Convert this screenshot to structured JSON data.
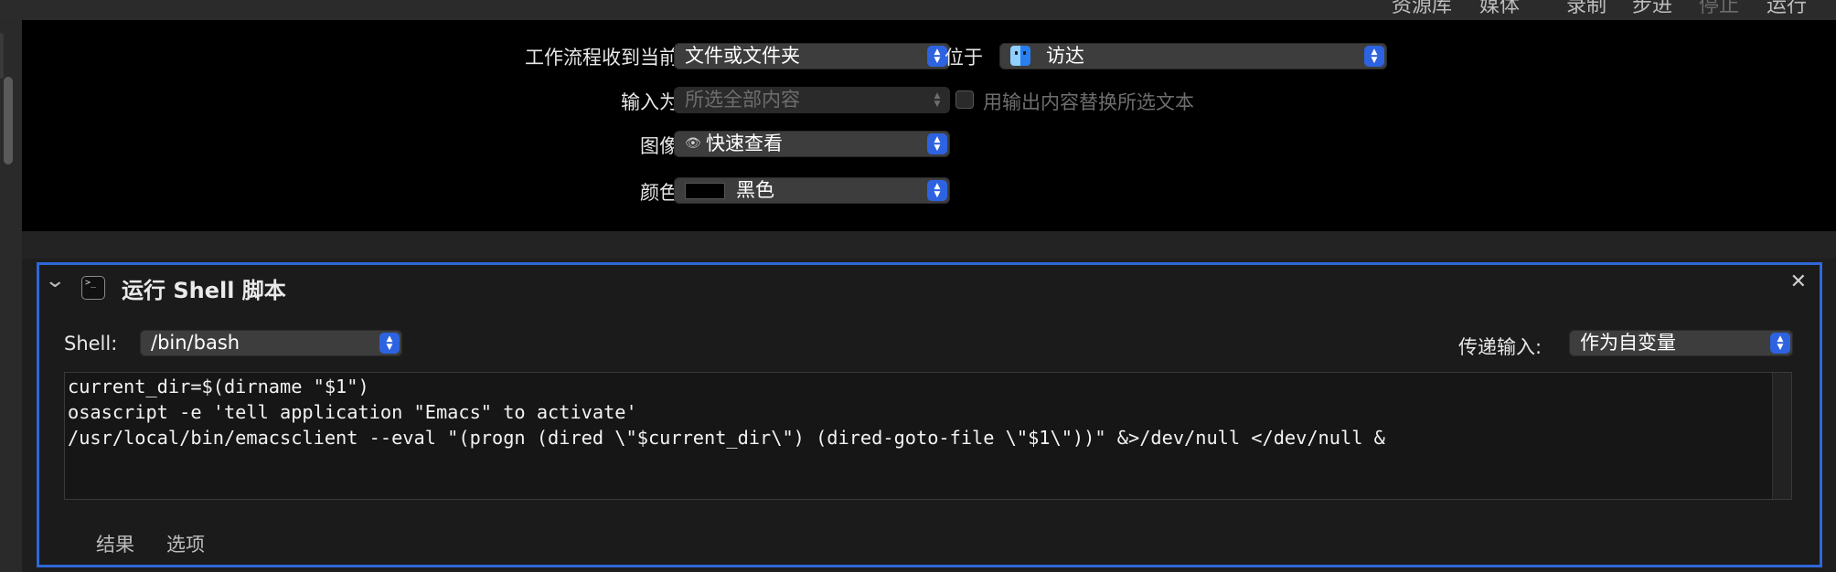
{
  "toolbar": {
    "items": [
      "资源库",
      "媒体",
      "录制",
      "步进",
      "停止",
      "运行"
    ]
  },
  "workflow_header": {
    "receive_label": "工作流程收到当前",
    "receive_value": "文件或文件夹",
    "location_label": "位于",
    "location_value": "访达",
    "input_label": "输入为",
    "input_value": "所选全部内容",
    "replace_checkbox_label": "用输出内容替换所选文本",
    "image_label": "图像",
    "image_value": "快速查看",
    "color_label": "颜色",
    "color_value": "黑色",
    "color_swatch": "#000000"
  },
  "action": {
    "title": "运行 Shell 脚本",
    "shell_label": "Shell:",
    "shell_value": "/bin/bash",
    "pass_input_label": "传递输入:",
    "pass_input_value": "作为自变量",
    "script_lines": [
      "current_dir=$(dirname \"$1\")",
      "osascript -e 'tell application \"Emacs\" to activate'",
      "/usr/local/bin/emacsclient --eval \"(progn (dired \\\"$current_dir\\\") (dired-goto-file \\\"$1\\\"))\" &>/dev/null </dev/null &"
    ],
    "tabs": [
      "结果",
      "选项"
    ],
    "accent_color": "#2f68d8"
  }
}
